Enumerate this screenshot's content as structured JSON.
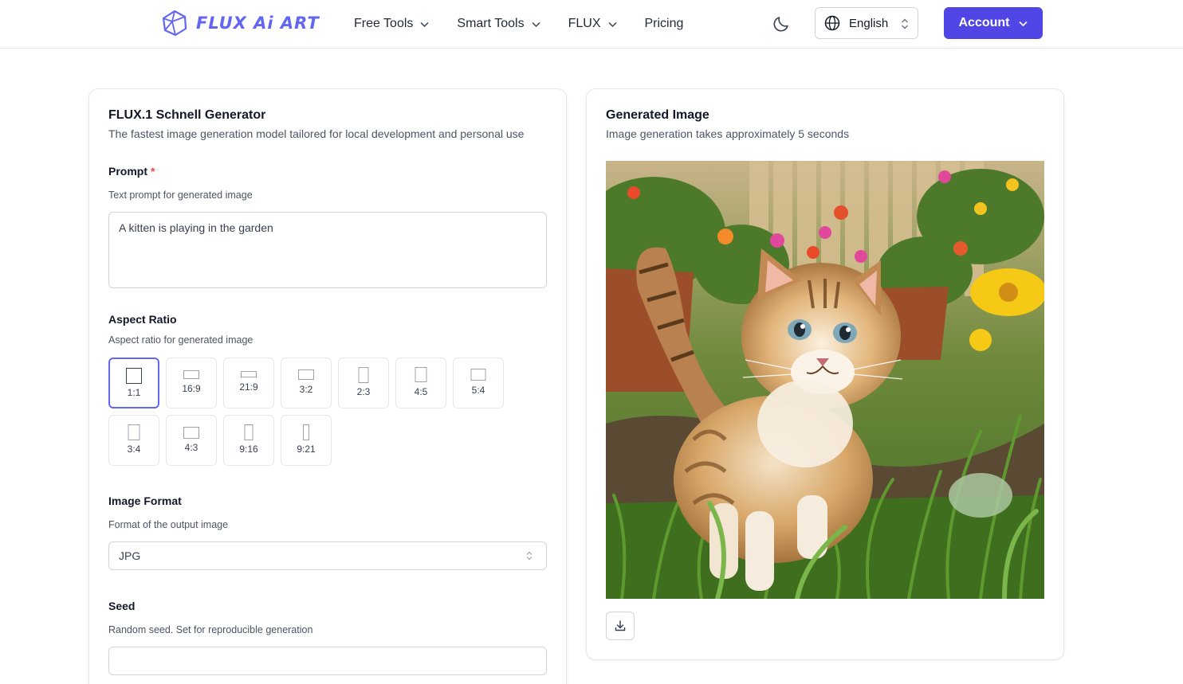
{
  "header": {
    "logo_text": "FLUX Ai ART",
    "nav": [
      {
        "label": "Free Tools",
        "has_dropdown": true
      },
      {
        "label": "Smart Tools",
        "has_dropdown": true
      },
      {
        "label": "FLUX",
        "has_dropdown": true
      },
      {
        "label": "Pricing",
        "has_dropdown": false
      }
    ],
    "language": "English",
    "account_label": "Account",
    "accent_color": "#4f46e5"
  },
  "generator": {
    "title": "FLUX.1 Schnell Generator",
    "subtitle": "The fastest image generation model tailored for local development and personal use",
    "prompt": {
      "label": "Prompt",
      "required_mark": "*",
      "help": "Text prompt for generated image",
      "value": "A kitten is playing in the garden"
    },
    "aspect_ratio": {
      "label": "Aspect Ratio",
      "help": "Aspect ratio for generated image",
      "selected": "1:1",
      "options": [
        "1:1",
        "16:9",
        "21:9",
        "3:2",
        "2:3",
        "4:5",
        "5:4",
        "3:4",
        "4:3",
        "9:16",
        "9:21"
      ]
    },
    "image_format": {
      "label": "Image Format",
      "help": "Format of the output image",
      "value": "JPG"
    },
    "seed": {
      "label": "Seed",
      "help": "Random seed. Set for reproducible generation",
      "value": ""
    }
  },
  "result": {
    "title": "Generated Image",
    "subtitle": "Image generation takes approximately 5 seconds",
    "image_alt": "kitten in garden",
    "download_icon": "download-icon"
  }
}
